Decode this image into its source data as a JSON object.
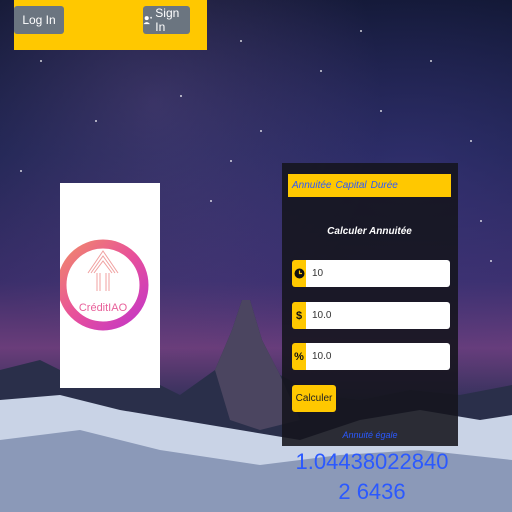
{
  "nav": {
    "login_label": "Log In",
    "signin_label": "Sign In",
    "signin_icon": "user-plus-icon"
  },
  "logo": {
    "text": "CréditIAO"
  },
  "tabs": [
    "Annuitée",
    "Capital",
    "Durée"
  ],
  "form": {
    "title": "Calculer Annuitée",
    "fields": [
      {
        "icon": "clock-icon",
        "value": "10"
      },
      {
        "icon": "dollar-icon",
        "value": "10.0"
      },
      {
        "icon": "percent-icon",
        "value": "10.0"
      }
    ],
    "submit_label": "Calculer"
  },
  "result": {
    "label": "Annuité égale",
    "value": "1.044380228402 6436"
  },
  "colors": {
    "accent": "#ffc800",
    "link_blue": "#2b59ff",
    "panel": "#14141c"
  }
}
